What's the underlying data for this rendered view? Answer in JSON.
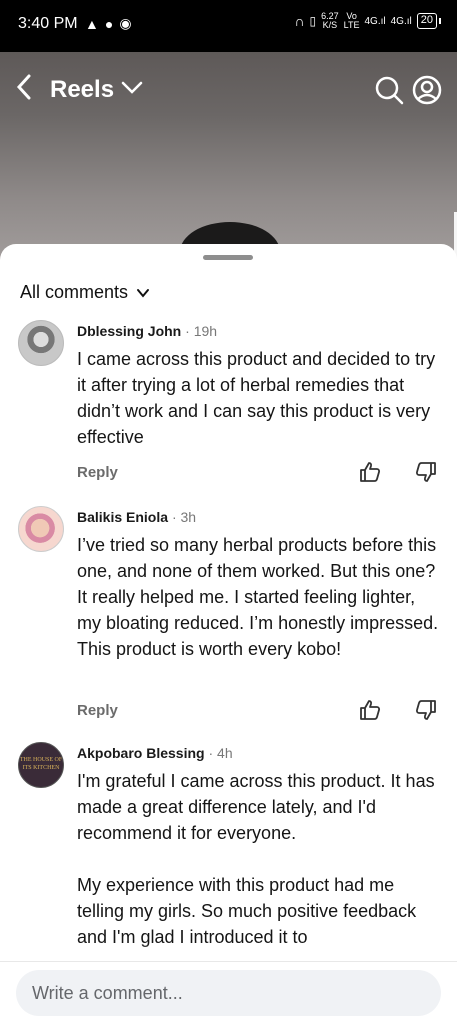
{
  "status_bar": {
    "time": "3:40 PM",
    "speed_value": "6.27",
    "speed_unit": "K/S",
    "volte": "Vo",
    "volte_sub": "LTE",
    "network1": "4G",
    "network2": "4G",
    "battery": "20"
  },
  "header": {
    "title": "Reels"
  },
  "comments_panel": {
    "sort_label": "All comments",
    "comments": [
      {
        "author": "Dblessing John",
        "time": "19h",
        "text": "I came across this product and decided to try it after trying a lot of herbal remedies that didn’t work and I can say this product is very effective",
        "reply_label": "Reply"
      },
      {
        "author": "Balikis Eniola",
        "time": "3h",
        "text": "I’ve tried so many herbal products before this one, and none of them worked. But this one? It really helped me. I started feeling lighter, my bloating reduced.  I’m honestly impressed. This product is worth every kobo!",
        "reply_label": "Reply"
      },
      {
        "author": "Akpobaro Blessing",
        "time": "4h",
        "text": "I'm grateful I came across this product. It has made a great difference lately, and I'd recommend it for everyone.\n\nMy experience with this product had me telling my girls. So much positive feedback and I'm glad I introduced it to",
        "avatar_text": "THE HOUSE OF ITS KITCHEN"
      }
    ]
  },
  "composer": {
    "placeholder": "Write a comment..."
  },
  "colors": {
    "sheet_bg": "#ffffff",
    "muted_text": "#777777",
    "input_bg": "#f0f2f5"
  }
}
